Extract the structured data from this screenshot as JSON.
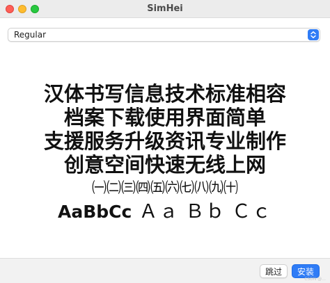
{
  "window": {
    "title": "SimHei"
  },
  "style_select": {
    "value": "Regular"
  },
  "preview": {
    "lines": [
      "汉体书写信息技术标准相容",
      "档案下载使用界面简单",
      "支援服务升级资讯专业制作",
      "创意空间快速无线上网",
      "㈠㈡㈢㈣㈤㈥㈦㈧㈨㈩"
    ],
    "latin_bold": "AaBbCc",
    "latin_wide": "Ａａ Ｂｂ Ｃｃ"
  },
  "footer": {
    "skip_label": "跳过",
    "install_label": "安装"
  },
  "watermark": "CSDN @..."
}
